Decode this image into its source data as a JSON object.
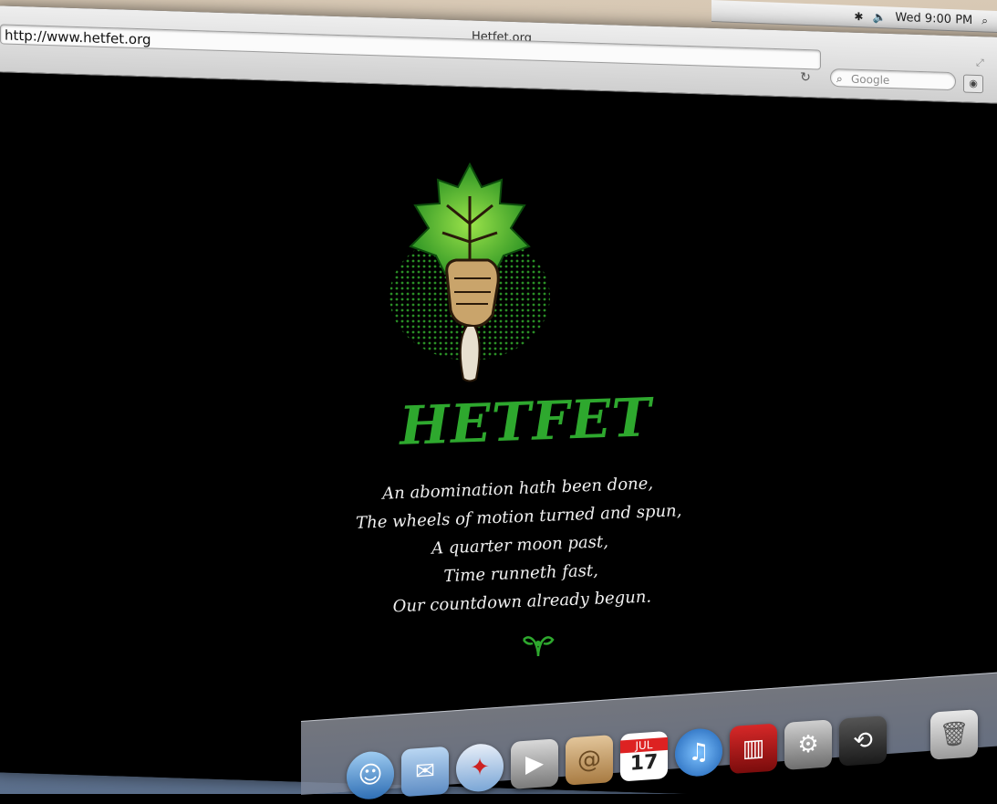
{
  "menubar": {
    "clock": "Wed 9:00 PM"
  },
  "browser": {
    "title": "Hetfet.org",
    "url": "http://www.hetfet.org",
    "search_placeholder": "Google"
  },
  "page": {
    "wordmark": "HETFET",
    "poem": [
      "An abomination hath been done,",
      "The wheels of motion turned and spun,",
      "A quarter moon past,",
      "Time runneth fast,",
      "Our countdown already begun."
    ]
  },
  "dock": {
    "calendar_month": "JUL",
    "calendar_day": "17"
  },
  "colors": {
    "leaf_green": "#3fbf2f",
    "wordmark_green": "#2ea82e"
  }
}
